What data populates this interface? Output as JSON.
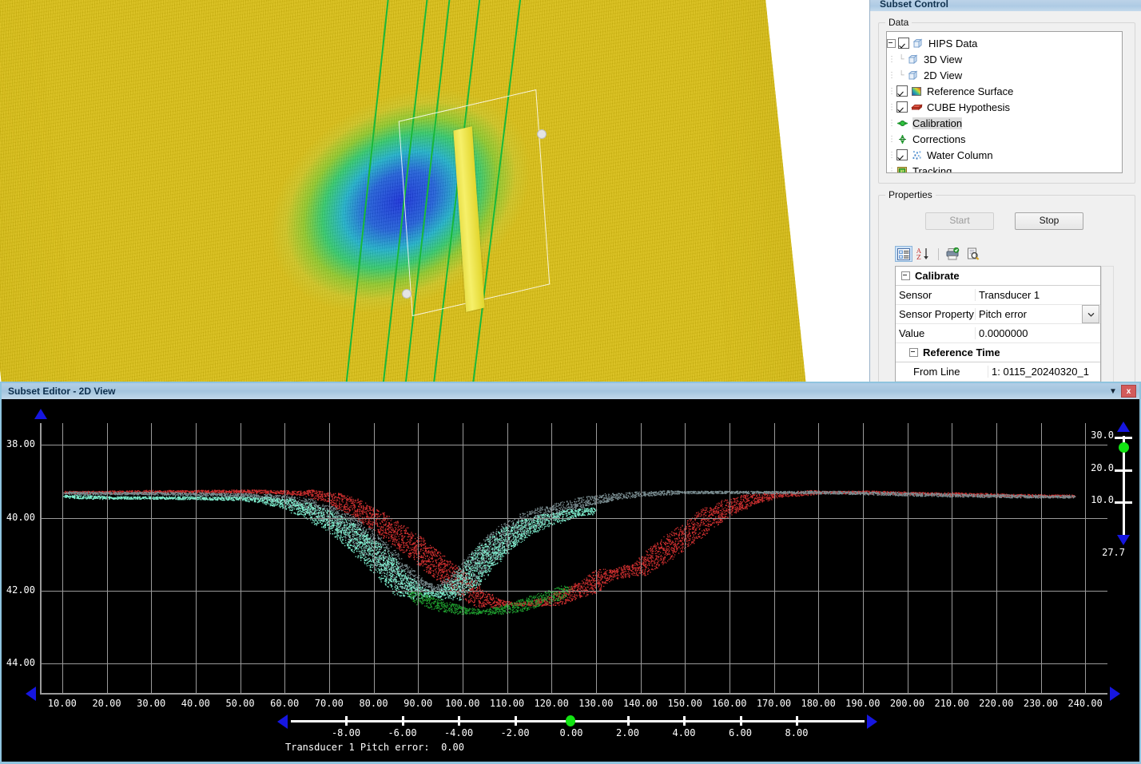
{
  "subset_control": {
    "title": "Subset Control",
    "data_group": {
      "label": "Data",
      "tree": [
        {
          "label": "HIPS Data",
          "icon": "cube-icon",
          "checked": true,
          "depth": 0,
          "expander": true,
          "selected": false
        },
        {
          "label": "3D View",
          "icon": "cube-icon",
          "checked": null,
          "depth": 1,
          "expander": false,
          "selected": false
        },
        {
          "label": "2D View",
          "icon": "cube-icon",
          "checked": null,
          "depth": 1,
          "expander": false,
          "selected": false
        },
        {
          "label": "Reference Surface",
          "icon": "gradient-icon",
          "checked": true,
          "depth": 1,
          "expander": false,
          "selected": false
        },
        {
          "label": "CUBE Hypothesis",
          "icon": "red-slab-icon",
          "checked": true,
          "depth": 1,
          "expander": false,
          "selected": false
        },
        {
          "label": "Calibration",
          "icon": "calibration-icon",
          "checked": null,
          "depth": 1,
          "expander": false,
          "selected": true
        },
        {
          "label": "Corrections",
          "icon": "corrections-icon",
          "checked": null,
          "depth": 1,
          "expander": false,
          "selected": false
        },
        {
          "label": "Water Column",
          "icon": "water-column-icon",
          "checked": true,
          "depth": 1,
          "expander": false,
          "selected": false
        },
        {
          "label": "Tracking",
          "icon": "tracking-icon",
          "checked": null,
          "depth": 1,
          "expander": false,
          "selected": false
        }
      ]
    },
    "properties_group": {
      "label": "Properties",
      "start_button": "Start",
      "stop_button": "Stop",
      "toolbar": [
        {
          "name": "categorized-icon",
          "active": true
        },
        {
          "name": "alphabetical-sort-icon",
          "active": false
        },
        {
          "name": "property-pages-icon",
          "active": false
        },
        {
          "name": "property-preview-icon",
          "active": false
        }
      ],
      "rows": [
        {
          "kind": "category",
          "key": "Calibrate",
          "value": "",
          "indent": 0,
          "dropdown": false
        },
        {
          "kind": "prop",
          "key": "Sensor",
          "value": "Transducer 1",
          "indent": 0,
          "dropdown": false
        },
        {
          "kind": "prop",
          "key": "Sensor Property",
          "value": "Pitch error",
          "indent": 0,
          "dropdown": true
        },
        {
          "kind": "prop",
          "key": "Value",
          "value": "0.0000000",
          "indent": 0,
          "dropdown": false
        },
        {
          "kind": "category",
          "key": "Reference Time",
          "value": "",
          "indent": 1,
          "dropdown": false
        },
        {
          "kind": "prop",
          "key": "From Line",
          "value": "1: 0115_20240320_1",
          "indent": 1,
          "dropdown": false
        }
      ]
    }
  },
  "view2d": {
    "title": "Subset Editor - 2D View",
    "minimize_glyph": "▼",
    "close_glyph": "x",
    "right_axis": {
      "ticks": [
        "30.0",
        "20.0",
        "10.0"
      ],
      "bottom_value": "27.7",
      "knob_value": "30.0"
    },
    "bottom_slider": {
      "ticks": [
        "-8.00",
        "-6.00",
        "-4.00",
        "-2.00",
        "0.00",
        "2.00",
        "4.00",
        "6.00",
        "8.00"
      ],
      "caption": "Transducer 1 Pitch error:  0.00",
      "knob_at": "0.00"
    }
  },
  "chart_data": {
    "type": "scatter",
    "title": "Subset Editor - 2D View",
    "xlabel": "",
    "ylabel": "",
    "grid": true,
    "legend": "none",
    "xlim": [
      5.0,
      245.0
    ],
    "ylim": [
      44.8,
      37.4
    ],
    "y_inverted": true,
    "xticks": [
      10.0,
      20.0,
      30.0,
      40.0,
      50.0,
      60.0,
      70.0,
      80.0,
      90.0,
      100.0,
      110.0,
      120.0,
      130.0,
      140.0,
      150.0,
      160.0,
      170.0,
      180.0,
      190.0,
      200.0,
      210.0,
      220.0,
      230.0,
      240.0
    ],
    "xticklabels": [
      "10.00",
      "20.00",
      "30.00",
      "40.00",
      "50.00",
      "60.00",
      "70.00",
      "80.00",
      "90.00",
      "100.00",
      "110.00",
      "120.00",
      "130.00",
      "140.00",
      "150.00",
      "160.00",
      "170.00",
      "180.00",
      "190.00",
      "200.00",
      "210.00",
      "220.00",
      "230.00",
      "240.00"
    ],
    "yticks": [
      38.0,
      40.0,
      42.0,
      44.0
    ],
    "yticklabels": [
      "38.00",
      "40.00",
      "42.00",
      "44.00"
    ],
    "series": [
      {
        "name": "red-line-soundings",
        "color": "#d03030",
        "x": [
          10,
          20,
          30,
          40,
          50,
          60,
          65,
          70,
          75,
          80,
          85,
          90,
          95,
          100,
          104,
          108,
          112,
          116,
          120,
          124,
          128,
          132,
          136,
          140,
          145,
          150,
          155,
          160,
          165,
          170,
          180,
          190,
          200,
          210,
          220,
          230,
          238
        ],
        "depth": [
          39.3,
          39.3,
          39.28,
          39.28,
          39.27,
          39.3,
          39.33,
          39.45,
          39.7,
          40.05,
          40.45,
          40.9,
          41.4,
          41.85,
          42.2,
          42.35,
          42.38,
          42.35,
          42.28,
          42.1,
          41.9,
          41.62,
          41.5,
          41.35,
          40.95,
          40.5,
          40.05,
          39.72,
          39.5,
          39.38,
          39.3,
          39.3,
          39.33,
          39.35,
          39.38,
          39.4,
          39.4
        ]
      },
      {
        "name": "gray-line-soundings",
        "color": "#7b8e92",
        "x": [
          10,
          20,
          30,
          40,
          50,
          55,
          60,
          65,
          70,
          74,
          78,
          82,
          86,
          90,
          94,
          98,
          102,
          106,
          110,
          114,
          118,
          122,
          128,
          134,
          140,
          148,
          156,
          164,
          172,
          180,
          190,
          200,
          210,
          220,
          230,
          238
        ],
        "depth": [
          39.32,
          39.33,
          39.33,
          39.35,
          39.38,
          39.42,
          39.5,
          39.68,
          39.95,
          40.25,
          40.65,
          41.1,
          41.55,
          41.85,
          41.95,
          41.8,
          41.4,
          40.92,
          40.5,
          40.15,
          39.92,
          39.75,
          39.55,
          39.42,
          39.35,
          39.3,
          39.3,
          39.3,
          39.3,
          39.3,
          39.32,
          39.35,
          39.38,
          39.4,
          39.42,
          39.42
        ]
      },
      {
        "name": "cyan-line-soundings",
        "color": "#7ff0d0",
        "x": [
          10,
          20,
          30,
          40,
          50,
          55,
          60,
          65,
          70,
          74,
          78,
          82,
          86,
          90,
          94,
          98,
          102,
          106,
          110,
          114,
          118,
          124,
          130
        ],
        "depth": [
          39.42,
          39.45,
          39.45,
          39.46,
          39.48,
          39.52,
          39.62,
          39.82,
          40.12,
          40.45,
          40.85,
          41.3,
          41.78,
          42.05,
          42.12,
          41.95,
          41.5,
          41.0,
          40.6,
          40.3,
          40.1,
          39.9,
          39.8
        ]
      },
      {
        "name": "green-rejected-soundings",
        "color": "#1f9e2f",
        "x": [
          88,
          92,
          96,
          100,
          104,
          108,
          112,
          116,
          120,
          124
        ],
        "depth": [
          42.15,
          42.3,
          42.45,
          42.55,
          42.6,
          42.55,
          42.45,
          42.3,
          42.15,
          42.0
        ]
      }
    ]
  }
}
